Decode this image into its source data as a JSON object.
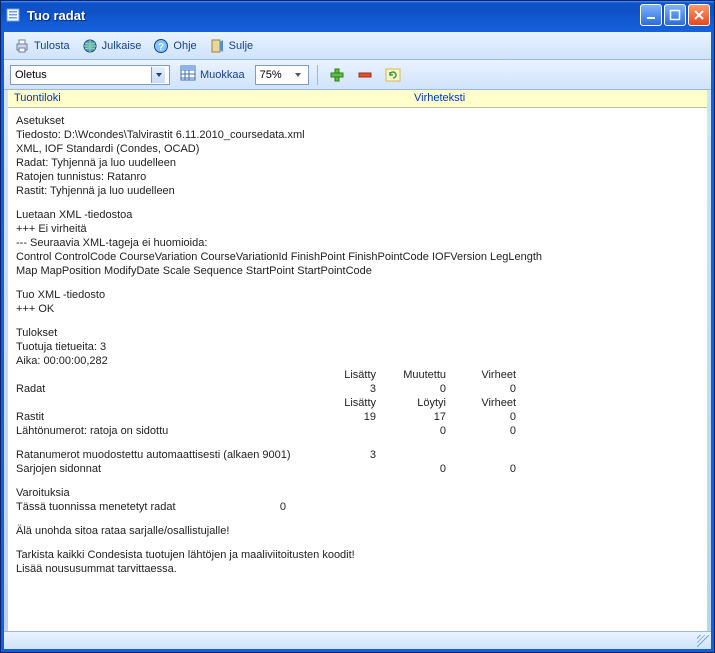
{
  "window": {
    "title": "Tuo radat"
  },
  "toolbar": {
    "print": "Tulosta",
    "publish": "Julkaise",
    "help": "Ohje",
    "close": "Sulje"
  },
  "toolbar2": {
    "combo_value": "Oletus",
    "edit": "Muokkaa",
    "zoom": "75%"
  },
  "tabs": {
    "log": "Tuontiloki",
    "errors": "Virheteksti"
  },
  "log": {
    "h_settings": "Asetukset",
    "l_file": "Tiedosto: D:\\Wcondes\\Talvirastit 6.11.2010_coursedata.xml",
    "l_xml": "XML, IOF Standardi (Condes, OCAD)",
    "l_radat": "Radat: Tyhjennä ja luo uudelleen",
    "l_ratojen": "Ratojen tunnistus: Ratanro",
    "l_rastit": "Rastit: Tyhjennä ja luo uudelleen",
    "h_read": "Luetaan XML -tiedostoa",
    "l_noerr": "+++ Ei virheitä",
    "l_ignore": "--- Seuraavia XML-tageja ei huomioida:",
    "l_tags1": "Control ControlCode CourseVariation CourseVariationId FinishPoint FinishPointCode IOFVersion LegLength",
    "l_tags2": "Map MapPosition ModifyDate Scale Sequence StartPoint StartPointCode",
    "h_import": "Tuo XML -tiedosto",
    "l_ok": "+++ OK",
    "h_results": "Tulokset",
    "l_count": "Tuotuja tietueita: 3",
    "l_time": "Aika: 00:00:00,282",
    "hdr1": {
      "c1": "Lisätty",
      "c2": "Muutettu",
      "c3": "Virheet"
    },
    "r_radat": {
      "label": "Radat",
      "v1": "3",
      "v2": "0",
      "v3": "0"
    },
    "hdr2": {
      "c1": "Lisätty",
      "c2": "Löytyi",
      "c3": "Virheet"
    },
    "r_rastit": {
      "label": "Rastit",
      "v1": "19",
      "v2": "17",
      "v3": "0"
    },
    "r_lahto": {
      "label": "Lähtönumerot: ratoja on sidottu",
      "v2": "0",
      "v3": "0"
    },
    "r_ratanum": {
      "label": "Ratanumerot muodostettu automaattisesti (alkaen 9001)",
      "v1": "3"
    },
    "r_sarjo": {
      "label": "Sarjojen sidonnat",
      "v2": "0",
      "v3": "0"
    },
    "h_warn": "Varoituksia",
    "r_lost": {
      "label": "Tässä tuonnissa menetetyt radat",
      "v1": "0"
    },
    "l_remind": "Älä unohda sitoa rataa sarjalle/osallistujalle!",
    "l_check": "Tarkista kaikki Condesista tuotujen lähtöjen ja maaliviitoitusten koodit!",
    "l_add": "Lisää noususummat tarvittaessa."
  }
}
